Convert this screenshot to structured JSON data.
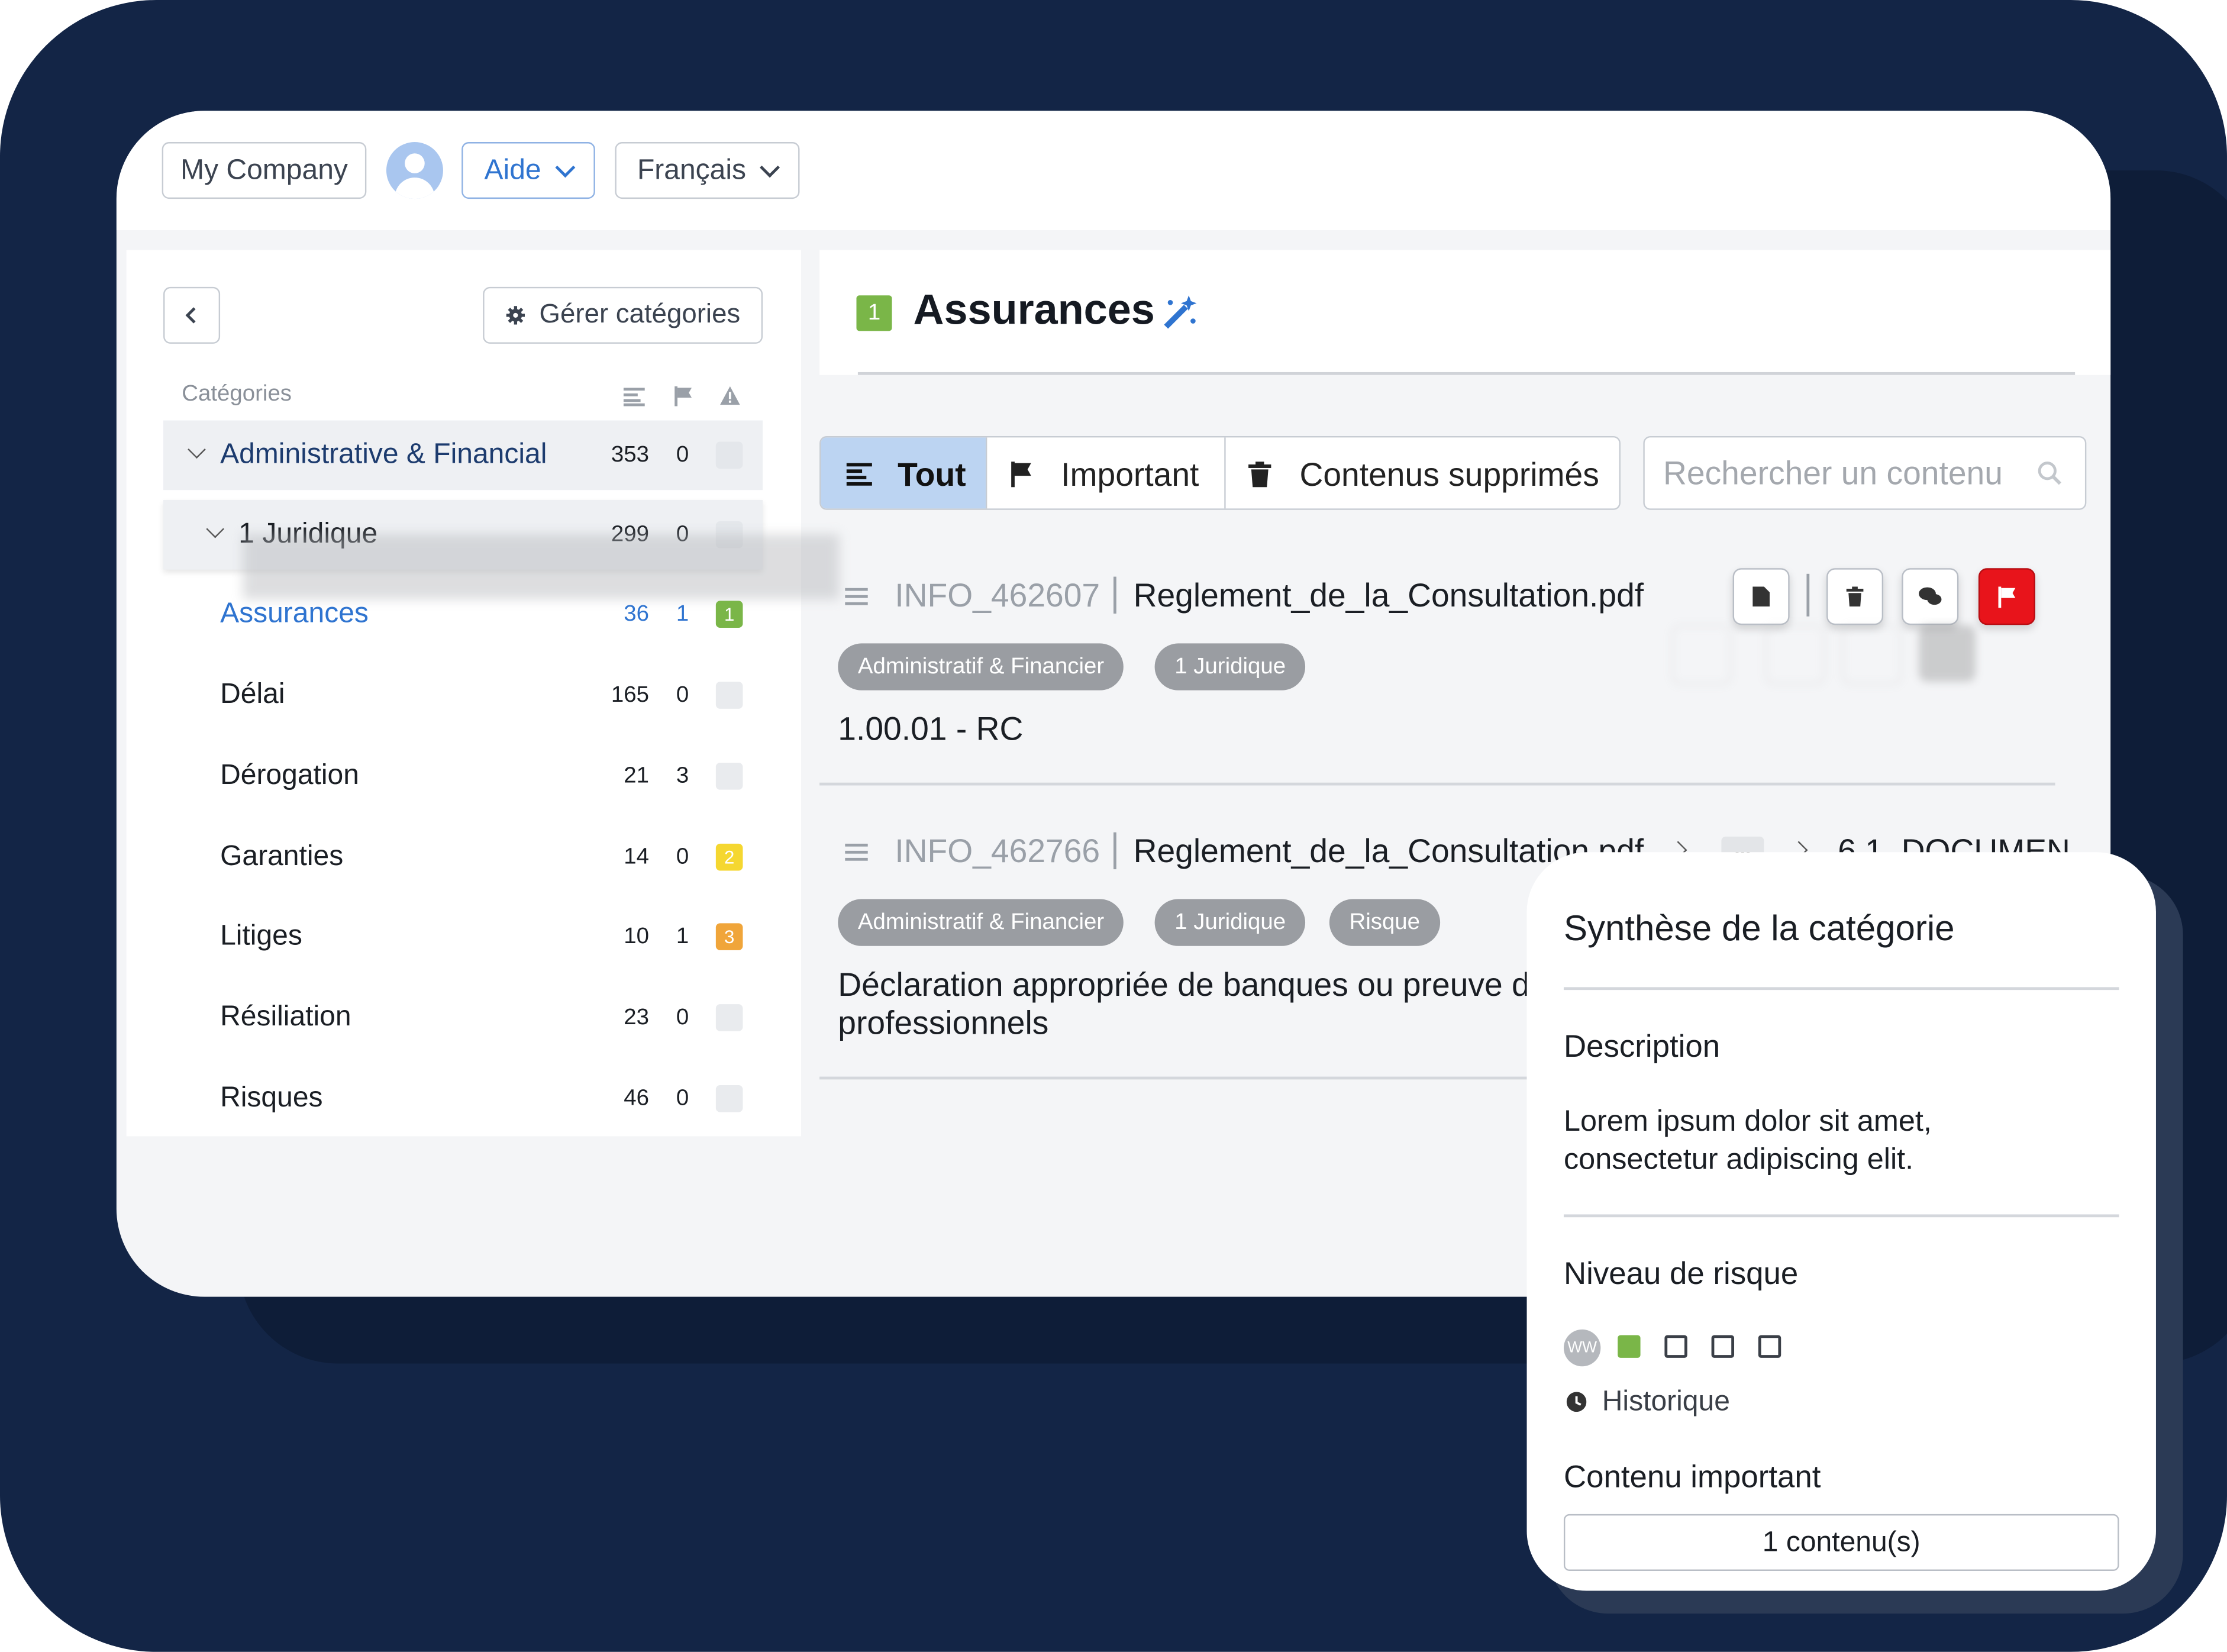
{
  "topbar": {
    "company": "My Company",
    "help": "Aide",
    "language": "Français"
  },
  "sidebar": {
    "manage_button": "Gérer catégories",
    "categories_header": "Catégories",
    "groups": [
      {
        "name": "Administrative & Financial",
        "count": "353",
        "flags": "0"
      },
      {
        "name": "1 Juridique",
        "count": "299",
        "flags": "0"
      }
    ],
    "items": [
      {
        "name": "Assurances",
        "count": "36",
        "flags": "1",
        "risk": "1",
        "risk_color": "#7ab648",
        "active": true
      },
      {
        "name": "Délai",
        "count": "165",
        "flags": "0",
        "risk": "-",
        "risk_color": "#e9ebee"
      },
      {
        "name": "Dérogation",
        "count": "21",
        "flags": "3",
        "risk": "-",
        "risk_color": "#e9ebee"
      },
      {
        "name": "Garanties",
        "count": "14",
        "flags": "0",
        "risk": "2",
        "risk_color": "#f5d730"
      },
      {
        "name": "Litiges",
        "count": "10",
        "flags": "1",
        "risk": "3",
        "risk_color": "#f0a53a"
      },
      {
        "name": "Résiliation",
        "count": "23",
        "flags": "0",
        "risk": "-",
        "risk_color": "#e9ebee"
      },
      {
        "name": "Risques",
        "count": "46",
        "flags": "0",
        "risk": "-",
        "risk_color": "#e9ebee"
      }
    ]
  },
  "main": {
    "title_badge": "1",
    "title": "Assurances",
    "tabs": {
      "all": "Tout",
      "important": "Important",
      "deleted": "Contenus supprimés"
    },
    "search_placeholder": "Rechercher un contenu",
    "entries": [
      {
        "id": "INFO_462607",
        "file": "Reglement_de_la_Consultation.pdf",
        "tags": [
          "Administratif & Financier",
          "1 Juridique"
        ],
        "text": "1.00.01 - RC"
      },
      {
        "id": "INFO_462766",
        "file": "Reglement_de_la_Consultation.pdf",
        "crumb_more": "...",
        "crumb_end": "6.1. DOCUMEN",
        "tags": [
          "Administratif & Financier",
          "1 Juridique",
          "Risque"
        ],
        "text_line1": "Déclaration appropriée de banques ou preuve d",
        "text_line2": "professionnels"
      }
    ]
  },
  "panel": {
    "title": "Synthèse de la catégorie",
    "description_label": "Description",
    "description_line1": "Lorem ipsum dolor sit amet,",
    "description_line2": "consectetur adipiscing elit.",
    "risk_label": "Niveau de risque",
    "risk_avatar": "WW",
    "risk_level": 1,
    "risk_max": 4,
    "history": "Historique",
    "important_label": "Contenu important",
    "important_value": "1 contenu(s)"
  },
  "colors": {
    "background": "#132546",
    "accent": "#2f74d0",
    "risk_green": "#7ab648",
    "flag_red": "#e8141b"
  }
}
